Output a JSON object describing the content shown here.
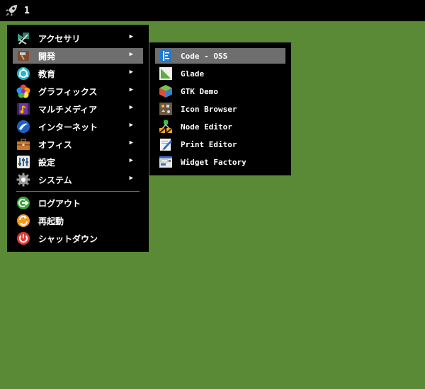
{
  "topbar": {
    "workspace": "1",
    "launcher_icon": "rocket-icon"
  },
  "menu": {
    "items": [
      {
        "label": "アクセサリ",
        "icon": "accessories-icon"
      },
      {
        "label": "開発",
        "icon": "development-hammer-icon"
      },
      {
        "label": "教育",
        "icon": "education-icon"
      },
      {
        "label": "グラフィックス",
        "icon": "graphics-icon"
      },
      {
        "label": "マルチメディア",
        "icon": "multimedia-icon"
      },
      {
        "label": "インターネット",
        "icon": "internet-icon"
      },
      {
        "label": "オフィス",
        "icon": "office-briefcase-icon"
      },
      {
        "label": "設定",
        "icon": "settings-icon"
      },
      {
        "label": "システム",
        "icon": "system-gear-icon"
      }
    ],
    "session": [
      {
        "label": "ログアウト",
        "icon": "logout-icon"
      },
      {
        "label": "再起動",
        "icon": "restart-icon"
      },
      {
        "label": "シャットダウン",
        "icon": "shutdown-icon"
      }
    ],
    "arrow": "▶"
  },
  "submenu": {
    "items": [
      {
        "label": "Code - OSS",
        "icon": "code-oss-icon"
      },
      {
        "label": "Glade",
        "icon": "glade-icon"
      },
      {
        "label": "GTK Demo",
        "icon": "gtk-demo-icon"
      },
      {
        "label": "Icon Browser",
        "icon": "icon-browser-icon"
      },
      {
        "label": "Node Editor",
        "icon": "node-editor-icon"
      },
      {
        "label": "Print Editor",
        "icon": "print-editor-icon"
      },
      {
        "label": "Widget Factory",
        "icon": "widget-factory-icon"
      }
    ]
  },
  "colors": {
    "desktop": "#5a8a35",
    "menu_bg": "#000000",
    "highlight": "#6e6e6e"
  }
}
